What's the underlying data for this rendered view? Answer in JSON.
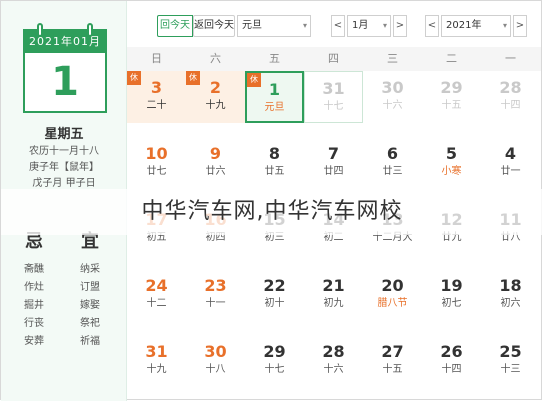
{
  "sidebar": {
    "header": "2021年01月",
    "day": "1",
    "weekday": "星期五",
    "lunar": "农历十一月十八",
    "ganzhi": "庚子年【鼠年】",
    "festival": "戊子月 甲子日"
  },
  "ji_yi": {
    "ji_label": "忌",
    "yi_label": "宜",
    "ji": [
      "斋醮",
      "作灶",
      "掘井",
      "行丧",
      "安葬"
    ],
    "yi": [
      "纳采",
      "订盟",
      "嫁娶",
      "祭祀",
      "祈福"
    ]
  },
  "toolbar": {
    "today": "回今天",
    "back": "返回今天",
    "holiday": "元旦",
    "month": "1月",
    "year": "2021年",
    "prev": "<",
    "next": ">",
    "caret": "▾"
  },
  "weekdays": [
    "日",
    "六",
    "五",
    "四",
    "三",
    "二",
    "一"
  ],
  "rows": [
    [
      {
        "d": "3",
        "l": "二十",
        "type": "hol",
        "badge": "休"
      },
      {
        "d": "2",
        "l": "十九",
        "type": "hol",
        "badge": "休"
      },
      {
        "d": "1",
        "l": "元旦",
        "type": "sel-today",
        "badge": "休"
      },
      {
        "d": "31",
        "l": "十七",
        "type": "dim outline"
      },
      {
        "d": "30",
        "l": "十六",
        "type": "dim"
      },
      {
        "d": "29",
        "l": "十五",
        "type": "dim"
      },
      {
        "d": "28",
        "l": "十四",
        "type": "dim"
      }
    ],
    [
      {
        "d": "10",
        "l": "廿七",
        "type": "wkend"
      },
      {
        "d": "9",
        "l": "廿六",
        "type": "wkend"
      },
      {
        "d": "8",
        "l": "廿五",
        "type": "norm"
      },
      {
        "d": "7",
        "l": "廿四",
        "type": "norm"
      },
      {
        "d": "6",
        "l": "廿三",
        "type": "norm"
      },
      {
        "d": "5",
        "l": "小寒",
        "type": "norm",
        "lred": true
      },
      {
        "d": "4",
        "l": "廿一",
        "type": "norm"
      }
    ],
    [
      {
        "d": "17",
        "l": "初五",
        "type": "wkend"
      },
      {
        "d": "16",
        "l": "初四",
        "type": "wkend"
      },
      {
        "d": "15",
        "l": "初三",
        "type": "norm"
      },
      {
        "d": "14",
        "l": "初二",
        "type": "norm"
      },
      {
        "d": "13",
        "l": "十二月大",
        "type": "norm"
      },
      {
        "d": "12",
        "l": "廿九",
        "type": "norm"
      },
      {
        "d": "11",
        "l": "廿八",
        "type": "norm"
      }
    ],
    [
      {
        "d": "24",
        "l": "十二",
        "type": "wkend"
      },
      {
        "d": "23",
        "l": "十一",
        "type": "wkend"
      },
      {
        "d": "22",
        "l": "初十",
        "type": "norm"
      },
      {
        "d": "21",
        "l": "初九",
        "type": "norm"
      },
      {
        "d": "20",
        "l": "腊八节",
        "type": "norm",
        "lred": true
      },
      {
        "d": "19",
        "l": "初七",
        "type": "norm"
      },
      {
        "d": "18",
        "l": "初六",
        "type": "norm"
      }
    ],
    [
      {
        "d": "31",
        "l": "十九",
        "type": "wkend"
      },
      {
        "d": "30",
        "l": "十八",
        "type": "wkend"
      },
      {
        "d": "29",
        "l": "十七",
        "type": "norm"
      },
      {
        "d": "28",
        "l": "十六",
        "type": "norm"
      },
      {
        "d": "27",
        "l": "十五",
        "type": "norm"
      },
      {
        "d": "26",
        "l": "十四",
        "type": "norm"
      },
      {
        "d": "25",
        "l": "十三",
        "type": "norm"
      }
    ]
  ],
  "watermark": "中华汽车网,中华汽车网校"
}
